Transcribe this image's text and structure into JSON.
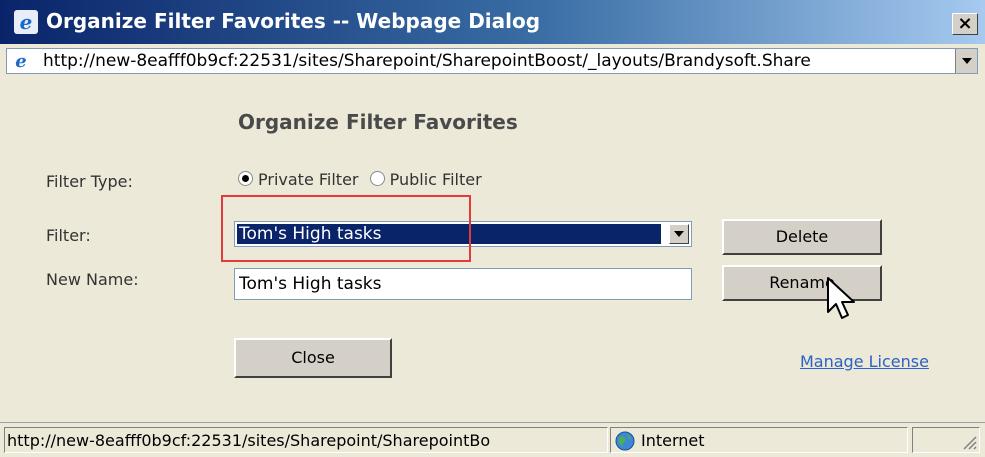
{
  "window": {
    "title": "Organize Filter Favorites -- Webpage Dialog",
    "close_glyph": "×",
    "address": "http://new-8eafff0b9cf:22531/sites/Sharepoint/SharepointBoost/_layouts/Brandysoft.Share"
  },
  "form": {
    "heading": "Organize Filter Favorites",
    "filter_type_label": "Filter Type:",
    "radio_options": [
      {
        "label": "Private Filter",
        "checked": true
      },
      {
        "label": "Public Filter",
        "checked": false
      }
    ],
    "filter_label": "Filter:",
    "filter_selected": "Tom's High tasks",
    "new_name_label": "New Name:",
    "new_name_value": "Tom's High tasks",
    "delete_button": "Delete",
    "rename_button": "Rename",
    "close_button": "Close",
    "manage_license_link": "Manage License"
  },
  "statusbar": {
    "url": "http://new-8eafff0b9cf:22531/sites/Sharepoint/SharepointBo",
    "zone": "Internet"
  },
  "colors": {
    "selection": "#0a246a",
    "highlight_box": "#e23b3b",
    "link": "#2b62c4"
  }
}
